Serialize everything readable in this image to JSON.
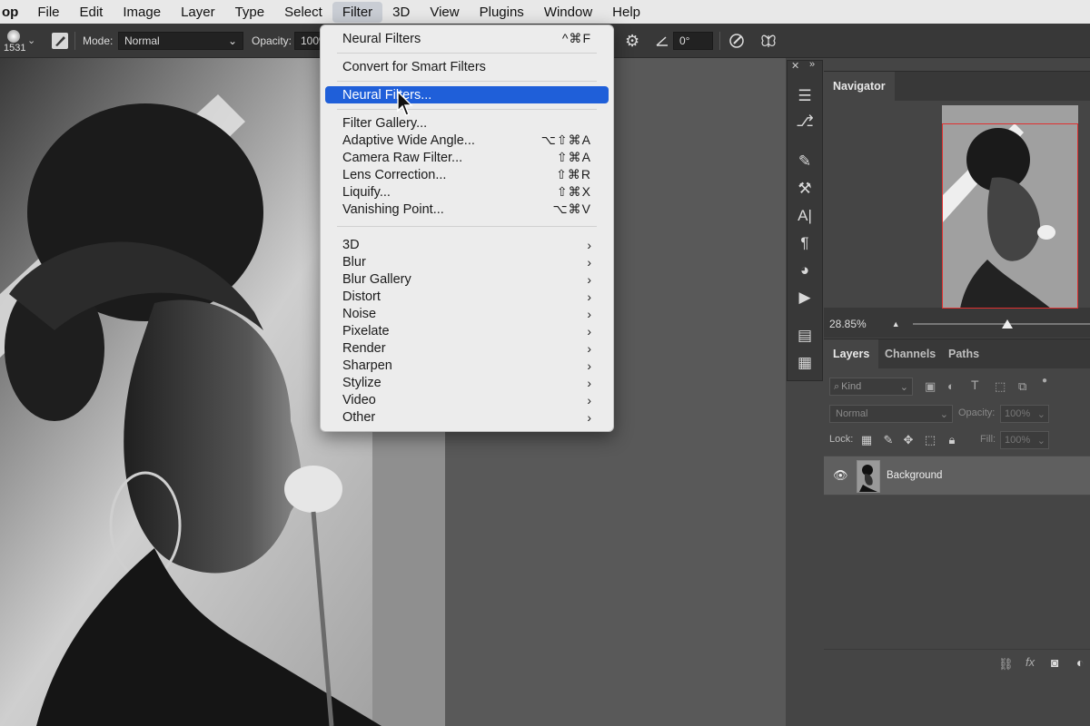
{
  "menubar": {
    "app_name": "op",
    "items": [
      "File",
      "Edit",
      "Image",
      "Layer",
      "Type",
      "Select",
      "Filter",
      "3D",
      "View",
      "Plugins",
      "Window",
      "Help"
    ],
    "active": "Filter"
  },
  "options": {
    "brush_size": "1531",
    "mode_label": "Mode:",
    "mode_value": "Normal",
    "opacity_label": "Opacity:",
    "opacity_value": "100%",
    "angle_value": "0°"
  },
  "filter_menu": {
    "top_items": [
      {
        "label": "Neural Filters",
        "shortcut": "^⌘F"
      },
      {
        "label": "Convert for Smart Filters",
        "shortcut": ""
      },
      {
        "label": "Neural Filters...",
        "shortcut": "",
        "highlighted": true
      }
    ],
    "group_items": [
      {
        "label": "Filter Gallery...",
        "shortcut": ""
      },
      {
        "label": "Adaptive Wide Angle...",
        "shortcut": "⌥⇧⌘A"
      },
      {
        "label": "Camera Raw Filter...",
        "shortcut": "⇧⌘A"
      },
      {
        "label": "Lens Correction...",
        "shortcut": "⇧⌘R"
      },
      {
        "label": "Liquify...",
        "shortcut": "⇧⌘X"
      },
      {
        "label": "Vanishing Point...",
        "shortcut": "⌥⌘V"
      }
    ],
    "submenus": [
      "3D",
      "Blur",
      "Blur Gallery",
      "Distort",
      "Noise",
      "Pixelate",
      "Render",
      "Sharpen",
      "Stylize",
      "Video",
      "Other"
    ]
  },
  "navigator": {
    "tab": "Navigator",
    "zoom": "28.85%"
  },
  "layers": {
    "tabs": [
      "Layers",
      "Channels",
      "Paths"
    ],
    "kind_placeholder": "Kind",
    "blend_mode": "Normal",
    "opacity_label": "Opacity:",
    "opacity_value": "100%",
    "lock_label": "Lock:",
    "fill_label": "Fill:",
    "fill_value": "100%",
    "items": [
      {
        "name": "Background",
        "visible": true
      }
    ]
  },
  "colors": {
    "highlight": "#1f5fd9",
    "panel_bg": "#383838",
    "navigator_frame": "#e03030"
  }
}
